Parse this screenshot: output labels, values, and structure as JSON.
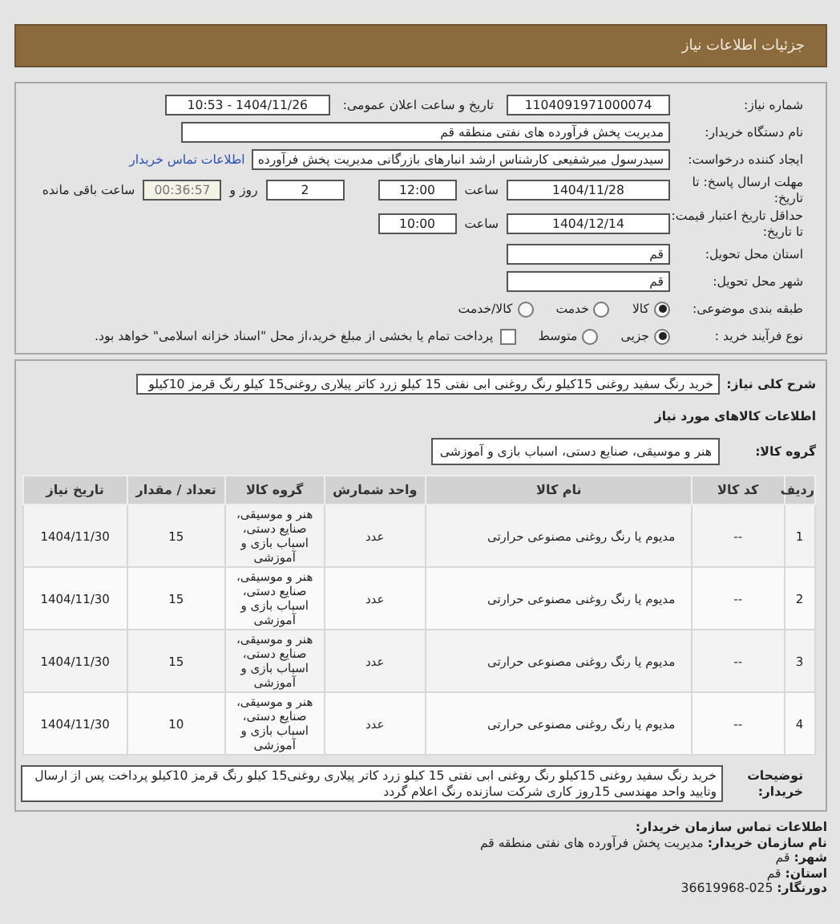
{
  "header": {
    "title": "جزئیات اطلاعات نیاز"
  },
  "need_number": {
    "label": "شماره نیاز:",
    "value": "1104091971000074"
  },
  "announce_date": {
    "label": "تاریخ و ساعت اعلان عمومی:",
    "value": "1404/11/26 - 10:53"
  },
  "buyer_org": {
    "label": "نام دستگاه خریدار:",
    "value": "مدیریت پخش فرآورده های نفتی منطقه قم"
  },
  "requester": {
    "label": "ایجاد کننده درخواست:",
    "value": "سیدرسول میرشفیعی کارشناس ارشد انبارهای بازرگانی مدیریت پخش فرآورده",
    "link": "اطلاعات تماس خریدار"
  },
  "deadline": {
    "label": "مهلت ارسال پاسخ: تا تاریخ:",
    "date": "1404/11/28",
    "time_label": "ساعت",
    "time": "12:00",
    "days": "2",
    "days_label": "روز و",
    "remaining": "00:36:57",
    "remaining_label": "ساعت باقی مانده"
  },
  "validity": {
    "label": "حداقل تاریخ اعتبار قیمت: تا تاریخ:",
    "date": "1404/12/14",
    "time_label": "ساعت",
    "time": "10:00"
  },
  "province": {
    "label": "استان محل تحویل:",
    "value": "قم"
  },
  "city": {
    "label": "شهر محل تحویل:",
    "value": "قم"
  },
  "category": {
    "label": "طبقه بندی موضوعی:",
    "options": [
      {
        "label": "کالا",
        "selected": true
      },
      {
        "label": "خدمت",
        "selected": false
      },
      {
        "label": "کالا/خدمت",
        "selected": false
      }
    ]
  },
  "purchase_type": {
    "label": "نوع فرآیند خرید :",
    "options": [
      {
        "label": "جزیی",
        "selected": true
      },
      {
        "label": "متوسط",
        "selected": false
      }
    ],
    "payment": {
      "checked": false,
      "label": "پرداخت تمام یا بخشی از مبلغ خرید،از محل \"اسناد خزانه اسلامی\" خواهد بود."
    }
  },
  "summary": {
    "label": "شرح کلی نیاز:",
    "value": "خرید رنگ سفید روغنی 15کیلو رنگ روغنی ابی نفتی 15 کیلو زرد کاتر پیلاری روغنی15 کیلو رنگ قرمز 10کیلو"
  },
  "goods_heading": "اطلاعات کالاهای مورد نیاز",
  "goods_group": {
    "label": "گروه کالا:",
    "value": "هنر و موسیقی، صنایع دستی، اسباب بازی و آموزشی"
  },
  "table": {
    "columns": [
      "ردیف",
      "کد کالا",
      "نام کالا",
      "واحد شمارش",
      "گروه کالا",
      "تعداد / مقدار",
      "تاریخ نیاز"
    ],
    "rows": [
      [
        "1",
        "--",
        "مدیوم یا رنگ روغنی مصنوعی حرارتی",
        "عدد",
        "هنر و موسیقی، صنایع دستی، اسباب بازی و آموزشی",
        "15",
        "1404/11/30"
      ],
      [
        "2",
        "--",
        "مدیوم یا رنگ روغنی مصنوعی حرارتی",
        "عدد",
        "هنر و موسیقی، صنایع دستی، اسباب بازی و آموزشی",
        "15",
        "1404/11/30"
      ],
      [
        "3",
        "--",
        "مدیوم یا رنگ روغنی مصنوعی حرارتی",
        "عدد",
        "هنر و موسیقی، صنایع دستی، اسباب بازی و آموزشی",
        "15",
        "1404/11/30"
      ],
      [
        "4",
        "--",
        "مدیوم یا رنگ روغنی مصنوعی حرارتی",
        "عدد",
        "هنر و موسیقی، صنایع دستی، اسباب بازی و آموزشی",
        "10",
        "1404/11/30"
      ]
    ]
  },
  "buyer_notes": {
    "label": "توضیحات خریدار:",
    "value": "خرید رنگ سفید روغنی 15کیلو رنگ روغنی ابی نفتی 15 کیلو زرد کاتر پیلاری روغنی15 کیلو رنگ قرمز 10کیلو پرداخت پس از ارسال وتایید واحد مهندسی 15روز کاری شرکت سازنده رنگ اعلام گردد"
  },
  "contact": {
    "heading": "اطلاعات تماس سازمان خریدار:",
    "items": [
      {
        "label": "نام سازمان خریدار:",
        "value": "مدیریت پخش فرآورده های نفتی منطقه قم"
      },
      {
        "label": "شهر:",
        "value": "قم"
      },
      {
        "label": "استان:",
        "value": "قم"
      },
      {
        "label": "دورنگار:",
        "value": "36619968-025"
      }
    ]
  }
}
